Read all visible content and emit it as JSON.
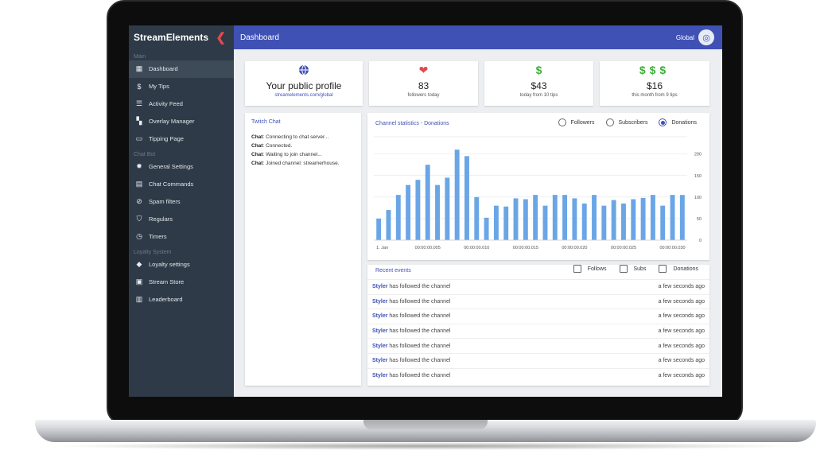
{
  "brand": "StreamElements",
  "header": {
    "title": "Dashboard",
    "scope": "Global"
  },
  "sidebar": {
    "sections": [
      {
        "label": "Main",
        "items": [
          {
            "label": "Dashboard",
            "icon": "dashboard-icon",
            "active": true
          },
          {
            "label": "My Tips",
            "icon": "dollar-icon"
          },
          {
            "label": "Activity Feed",
            "icon": "list-icon"
          },
          {
            "label": "Overlay Manager",
            "icon": "grid-icon"
          },
          {
            "label": "Tipping Page",
            "icon": "monitor-icon"
          }
        ]
      },
      {
        "label": "Chat Bot",
        "items": [
          {
            "label": "General Settings",
            "icon": "gear-icon"
          },
          {
            "label": "Chat Commands",
            "icon": "chat-icon"
          },
          {
            "label": "Spam filters",
            "icon": "block-icon"
          },
          {
            "label": "Regulars",
            "icon": "shield-icon"
          },
          {
            "label": "Timers",
            "icon": "timer-icon"
          }
        ]
      },
      {
        "label": "Loyalty System",
        "items": [
          {
            "label": "Loyalty settings",
            "icon": "tag-icon"
          },
          {
            "label": "Stream Store",
            "icon": "store-icon"
          },
          {
            "label": "Leaderboard",
            "icon": "chart-icon"
          }
        ]
      }
    ]
  },
  "stats": {
    "profile": {
      "title": "Your public profile",
      "link": "streamelements.com/global"
    },
    "followers": {
      "value": "83",
      "label": "followers today"
    },
    "tips_today": {
      "value": "$43",
      "label": "today from 10 tips"
    },
    "tips_month": {
      "value": "$16",
      "label": "this month from 9 tips"
    }
  },
  "chat": {
    "title": "Twitch Chat",
    "lines": [
      {
        "who": "Chat",
        "text": ": Connecting to chat server..."
      },
      {
        "who": "Chat",
        "text": ": Connected."
      },
      {
        "who": "Chat",
        "text": ": Waiting to join channel..."
      },
      {
        "who": "Chat",
        "text": ": Joined channel: streamerhouse."
      }
    ]
  },
  "channel_stats": {
    "title": "Channel statistics - Donations",
    "options": [
      "Followers",
      "Subscribers",
      "Donations"
    ],
    "selected": "Donations"
  },
  "chart_data": {
    "type": "bar",
    "color": "#6aa6e6",
    "values": [
      50,
      70,
      105,
      128,
      140,
      175,
      128,
      145,
      210,
      195,
      100,
      52,
      80,
      78,
      97,
      95,
      105,
      80,
      105,
      105,
      97,
      85,
      105,
      80,
      93,
      85,
      95,
      98,
      105,
      80,
      105,
      105
    ],
    "x_tick_labels": [
      "1. Jan",
      "00:00:00.005",
      "00:00:00.010",
      "00:00:00.015",
      "00:00:00.020",
      "00:00:00.025",
      "00:00:00.030"
    ],
    "y_ticks": [
      0,
      50,
      100,
      150,
      200
    ],
    "ylim": [
      0,
      240
    ],
    "grid": true
  },
  "events": {
    "title": "Recent events",
    "filters": [
      "Follows",
      "Subs",
      "Donations"
    ],
    "rows": [
      {
        "user": "Styler",
        "action": " has followed the channel",
        "time": "a few seconds ago"
      },
      {
        "user": "Styler",
        "action": " has followed the channel",
        "time": "a few seconds ago"
      },
      {
        "user": "Styler",
        "action": " has followed the channel",
        "time": "a few seconds ago"
      },
      {
        "user": "Styler",
        "action": " has followed the channel",
        "time": "a few seconds ago"
      },
      {
        "user": "Styler",
        "action": " has followed the channel",
        "time": "a few seconds ago"
      },
      {
        "user": "Styler",
        "action": " has followed the channel",
        "time": "a few seconds ago"
      },
      {
        "user": "Styler",
        "action": " has followed the channel",
        "time": "a few seconds ago"
      }
    ]
  }
}
